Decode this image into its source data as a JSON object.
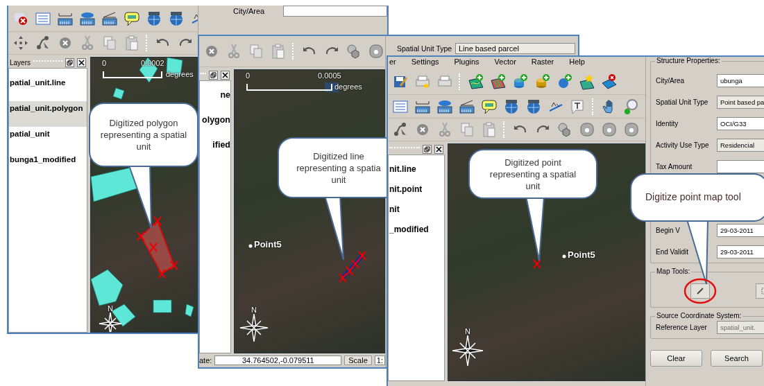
{
  "windows": [
    {
      "kind": "polygon",
      "form": [
        {
          "label": "City/Area",
          "kind": "text"
        }
      ],
      "layers": {
        "title": "Layers",
        "items": [
          {
            "label": "patial_unit.line",
            "selected": false
          },
          {
            "label": "patial_unit.polygon",
            "selected": true
          },
          {
            "label": "patial_unit",
            "selected": false
          },
          {
            "label": "bunga1_modified",
            "selected": false
          }
        ]
      },
      "map": {
        "scale_start": "0",
        "scale_end": "0.0002",
        "scale_unit": "degrees",
        "north": "N"
      }
    },
    {
      "kind": "line",
      "form": [
        {
          "label": "Spatial Unit Type",
          "value": "Line based parcel",
          "kind": "dropdown"
        }
      ],
      "layers": {
        "items": [
          {
            "label": "ne",
            "selected": false
          },
          {
            "label": "olygon",
            "selected": false
          },
          {
            "label": "ified",
            "selected": false
          }
        ]
      },
      "map": {
        "scale_start": "0",
        "scale_end": "0.0005",
        "scale_unit": "degrees",
        "point_label": "Point5",
        "north": "N"
      },
      "status_bar": {
        "label": "ate:",
        "coordinate": "34.764502,-0.079511",
        "scale_button": "Scale",
        "scale_value": "1:"
      }
    },
    {
      "kind": "point",
      "menu": [
        "er",
        "Settings",
        "Plugins",
        "Vector",
        "Raster",
        "Help"
      ],
      "layers": {
        "items": [
          {
            "label": "nit.line",
            "selected": false
          },
          {
            "label": "nit.point",
            "selected": false
          },
          {
            "label": "nit",
            "selected": false
          },
          {
            "label": "_modified",
            "selected": false
          }
        ]
      },
      "map": {
        "point_label": "Point5",
        "north": "N"
      },
      "panel": {
        "groups": [
          {
            "title": "Structure Properties:",
            "fields": [
              {
                "label": "City/Area",
                "value": "ubunga",
                "kind": "text"
              },
              {
                "label": "Spatial Unit Type",
                "value": "Point based pa",
                "kind": "dropdown"
              },
              {
                "label": "Identity",
                "value": "OCI/G33",
                "kind": "text"
              },
              {
                "label": "Activity Use Type",
                "value": "Residencial",
                "kind": "dropdown"
              },
              {
                "label": "Tax Amount",
                "kind": "text"
              },
              {
                "kind": "hidden"
              },
              {
                "label": "Begin V",
                "value": "29-03-2011",
                "kind": "text"
              },
              {
                "label": "End Validit",
                "value": "29-03-2011",
                "kind": "text"
              }
            ]
          },
          {
            "title": "Map Tools:",
            "tools": [
              {
                "kind": "digitize",
                "highlighted": true
              },
              {
                "kind": "other",
                "highlighted": false
              }
            ]
          },
          {
            "title": "Source Coordinate System:",
            "fields": [
              {
                "label": "Reference Layer",
                "value": "spatial_unit.",
                "kind": "disabled"
              }
            ]
          }
        ],
        "buttons": [
          "Clear",
          "Search"
        ]
      }
    }
  ],
  "callouts": [
    {
      "text": "Digitized polygon\nrepresenting a spatial\nunit"
    },
    {
      "text": "Digitized line\nrepresenting a spatia\nunit"
    },
    {
      "text": "Digitized point\nrepresenting a spatial\nunit"
    },
    {
      "text": "Digitize point map tool"
    }
  ]
}
